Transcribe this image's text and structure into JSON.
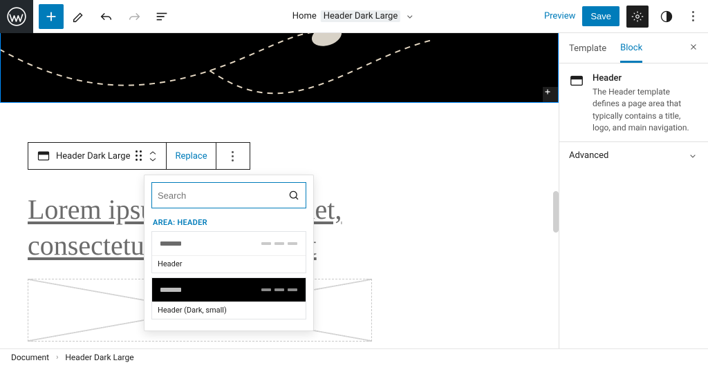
{
  "topbar": {
    "preview_label": "Preview",
    "save_label": "Save"
  },
  "doc": {
    "page_label": "Home",
    "part_label": "Header Dark Large"
  },
  "block_toolbar": {
    "block_label": "Header Dark Large",
    "replace_label": "Replace"
  },
  "heading_text": "Lorem ipsum dolor sit amet, consectetur adipiscing elit",
  "popover": {
    "search_placeholder": "Search",
    "section_label": "AREA: HEADER",
    "options": [
      {
        "label": "Header",
        "dark": false
      },
      {
        "label": "Header (Dark, small)",
        "dark": true
      }
    ]
  },
  "sidebar": {
    "tab_template": "Template",
    "tab_block": "Block",
    "block_title": "Header",
    "block_desc": "The Header template defines a page area that typically contains a title, logo, and main navigation.",
    "accordion_label": "Advanced"
  },
  "breadcrumb": {
    "root": "Document",
    "leaf": "Header Dark Large"
  }
}
